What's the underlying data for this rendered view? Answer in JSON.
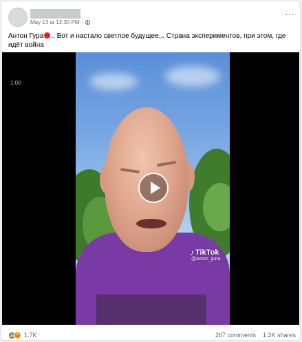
{
  "post": {
    "timestamp": "May 13 at 12:30 PM",
    "text_before": "Антон Гура",
    "text_after": ".. Вот и настало светлое будущее... Страна экспериментов, при этом, где идёт война",
    "more_icon": "···"
  },
  "video": {
    "time": "1:00",
    "tiktok_label": "TikTok",
    "tiktok_note": "♪",
    "handle": "@anton_gura"
  },
  "footer": {
    "reactions_count": "1.7K",
    "comments": "267 comments",
    "shares": "1.2K shares",
    "like_glyph": "👍",
    "angry_glyph": "😡"
  }
}
